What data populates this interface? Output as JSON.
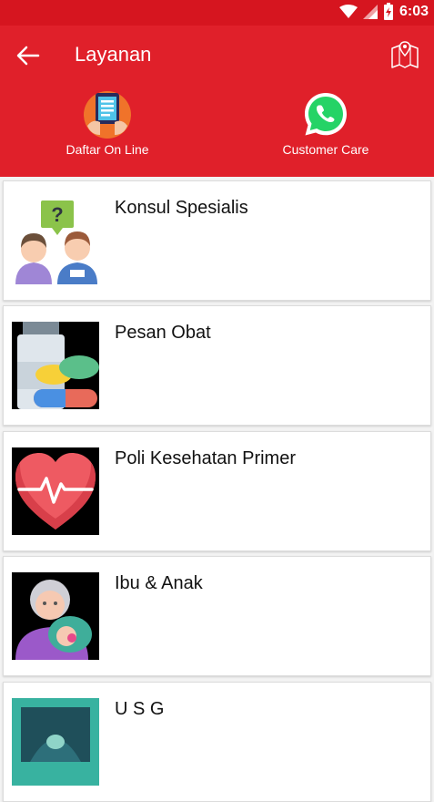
{
  "status": {
    "time": "6:03"
  },
  "header": {
    "title": "Layanan"
  },
  "quick_actions": [
    {
      "label": "Daftar On Line",
      "icon": "registration-tablet-icon"
    },
    {
      "label": "Customer Care",
      "icon": "whatsapp-icon"
    }
  ],
  "services": [
    {
      "label": "Konsul Spesialis",
      "icon": "consultation-icon"
    },
    {
      "label": "Pesan Obat",
      "icon": "medicine-icon"
    },
    {
      "label": "Poli Kesehatan Primer",
      "icon": "heart-pulse-icon"
    },
    {
      "label": "Ibu & Anak",
      "icon": "mother-child-icon"
    },
    {
      "label": "U S G",
      "icon": "ultrasound-icon"
    }
  ],
  "colors": {
    "primary": "#e0202a",
    "status_bar": "#d6151f"
  }
}
